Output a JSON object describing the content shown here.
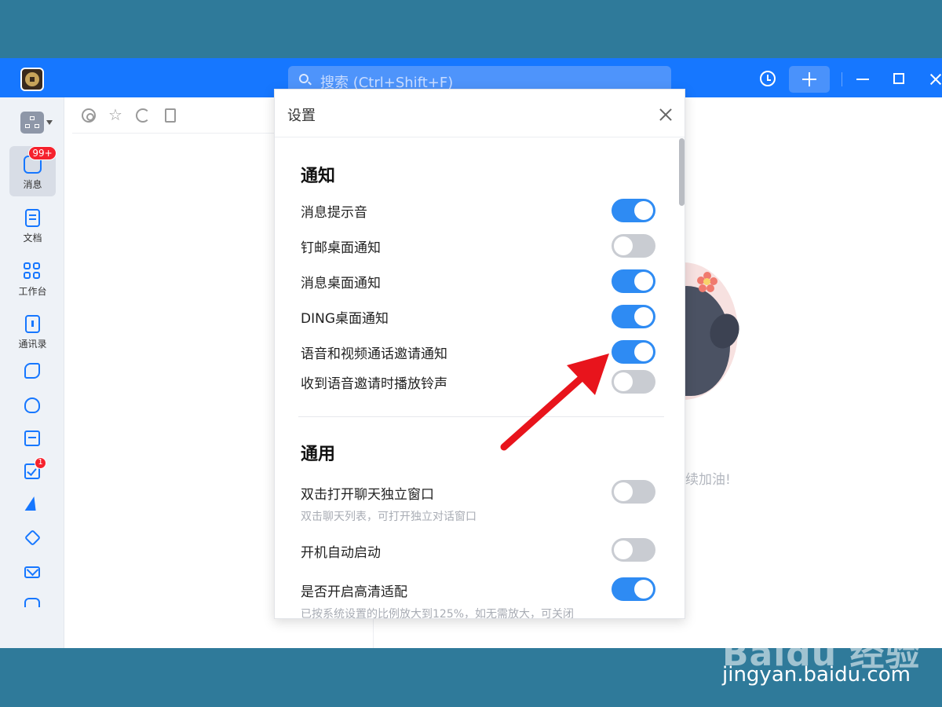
{
  "titlebar": {
    "search_placeholder": "搜索 (Ctrl+Shift+F)"
  },
  "nav": {
    "items": [
      {
        "label": "消息",
        "icon": "message-icon"
      },
      {
        "label": "文档",
        "icon": "document-icon"
      },
      {
        "label": "工作台",
        "icon": "workbench-icon"
      },
      {
        "label": "通讯录",
        "icon": "contacts-icon"
      }
    ],
    "message_badge": "99+",
    "todo_badge": "1",
    "more": "···"
  },
  "settings": {
    "title": "设置",
    "notify_section": "通知",
    "notify_options": [
      {
        "label": "消息提示音",
        "on": true
      },
      {
        "label": "钉邮桌面通知",
        "on": false
      },
      {
        "label": "消息桌面通知",
        "on": true
      },
      {
        "label": "DING桌面通知",
        "on": true
      },
      {
        "label": "语音和视频通话邀请通知",
        "on": true
      },
      {
        "label": "收到语音邀请时播放铃声",
        "on": false
      }
    ],
    "general_section": "通用",
    "general_options": [
      {
        "label": "双击打开聊天独立窗口",
        "desc": "双击聊天列表，可打开独立对话窗口",
        "on": false
      },
      {
        "label": "开机自动启动",
        "on": false
      },
      {
        "label": "是否开启高清适配",
        "desc": "已按系统设置的比例放大到125%，如无需放大，可关闭",
        "on": true
      }
    ]
  },
  "background": {
    "empty_text": "续加油!"
  },
  "watermark": {
    "logo": "Baidu 经验",
    "url": "jingyan.baidu.com"
  },
  "colors": {
    "brand_blue": "#1677ff",
    "toggle_on": "#2e8bf3",
    "toggle_off": "#c9ccd2",
    "badge_red": "#f5222d",
    "outer_bg": "#2f7a9a",
    "arrow_red": "#e8141c"
  }
}
